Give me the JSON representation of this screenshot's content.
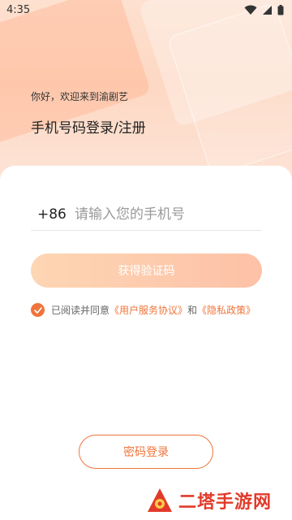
{
  "status_bar": {
    "time": "4:35",
    "icons": [
      "wifi-icon",
      "signal-icon",
      "battery-icon"
    ]
  },
  "hero": {
    "greeting": "你好，欢迎来到渝剧艺",
    "heading": "手机号码登录/注册"
  },
  "login_form": {
    "country_code": "+86",
    "phone_placeholder": "请输入您的手机号",
    "get_code_label": "获得验证码",
    "agreement": {
      "checked": true,
      "prefix": "已阅读并同意",
      "user_agreement": "《用户服务协议》",
      "conjunction": "和",
      "privacy_policy": "《隐私政策》"
    },
    "password_login_label": "密码登录"
  },
  "watermark": {
    "text": "二塔手游网"
  },
  "colors": {
    "accent": "#f0743b",
    "button_gradient_start": "#fdd6b4",
    "button_gradient_end": "#fdc1a7",
    "hero_background": "#fde0cf"
  }
}
